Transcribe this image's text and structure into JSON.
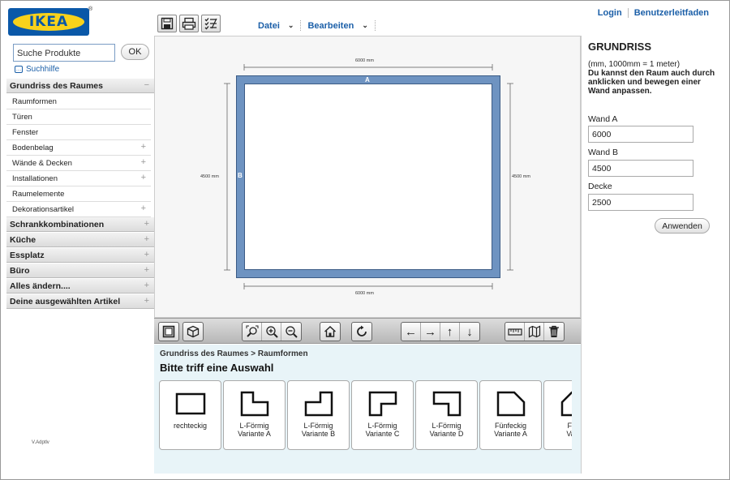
{
  "brand": {
    "logo_text": "IKEA",
    "reg_mark": "®"
  },
  "search": {
    "value": "Suche Produkte",
    "ok_label": "OK",
    "help_label": "Suchhilfe"
  },
  "nav": {
    "room_section": {
      "label": "Grundriss des Raumes",
      "toggle": "−"
    },
    "room_items": [
      {
        "label": "Raumformen",
        "expandable": false
      },
      {
        "label": "Türen",
        "expandable": false
      },
      {
        "label": "Fenster",
        "expandable": false
      },
      {
        "label": "Bodenbelag",
        "expandable": true
      },
      {
        "label": "Wände & Decken",
        "expandable": true
      },
      {
        "label": "Installationen",
        "expandable": true
      },
      {
        "label": "Raumelemente",
        "expandable": false
      },
      {
        "label": "Dekorationsartikel",
        "expandable": true
      }
    ],
    "categories": [
      {
        "label": "Schrankkombinationen"
      },
      {
        "label": "Küche"
      },
      {
        "label": "Essplatz"
      },
      {
        "label": "Büro"
      },
      {
        "label": "Alles ändern...."
      },
      {
        "label": "Deine ausgewählten Artikel"
      }
    ],
    "plus": "+"
  },
  "version_text": "V.Adptlv",
  "menu": {
    "file": "Datei",
    "edit": "Bearbeiten"
  },
  "toplinks": {
    "login": "Login",
    "guide": "Benutzerleitfaden"
  },
  "canvas": {
    "dim_top": "6000 mm",
    "dim_bottom": "6000 mm",
    "dim_left": "4500 mm",
    "dim_right": "4500 mm",
    "wall_a": "A",
    "wall_b": "B"
  },
  "shapes": {
    "breadcrumb": "Grundriss des Raumes > Raumformen",
    "title": "Bitte triff eine Auswahl",
    "tiles": [
      {
        "line1": "rechteckig",
        "line2": ""
      },
      {
        "line1": "L-Förmig",
        "line2": "Variante A"
      },
      {
        "line1": "L-Förmig",
        "line2": "Variante B"
      },
      {
        "line1": "L-Förmig",
        "line2": "Variante C"
      },
      {
        "line1": "L-Förmig",
        "line2": "Variante D"
      },
      {
        "line1": "Fünfeckig",
        "line2": "Variante A"
      },
      {
        "line1": "Fünf",
        "line2": "Varia"
      }
    ]
  },
  "panel": {
    "title": "GRUNDRISS",
    "units": "(mm, 1000mm = 1 meter)",
    "hint": "Du kannst den Raum auch durch anklicken und bewegen einer Wand anpassen.",
    "wall_a_label": "Wand A",
    "wall_a_value": "6000",
    "wall_b_label": "Wand B",
    "wall_b_value": "4500",
    "ceiling_label": "Decke",
    "ceiling_value": "2500",
    "apply_label": "Anwenden"
  }
}
